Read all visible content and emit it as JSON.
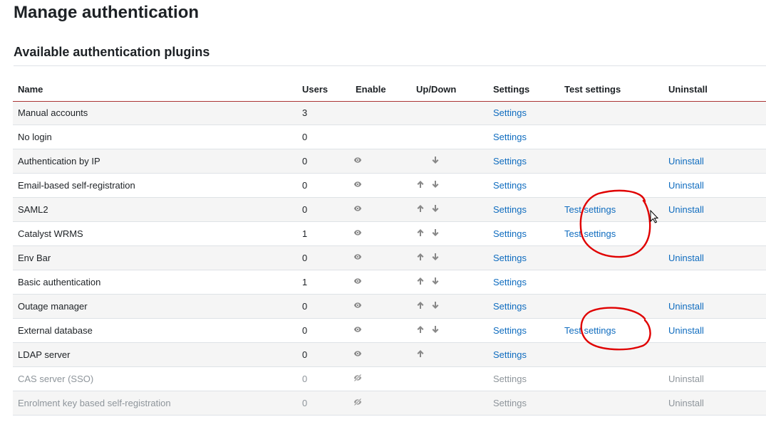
{
  "page": {
    "title": "Manage authentication",
    "section_title": "Available authentication plugins"
  },
  "table": {
    "headers": {
      "name": "Name",
      "users": "Users",
      "enable": "Enable",
      "updown": "Up/Down",
      "settings": "Settings",
      "test_settings": "Test settings",
      "uninstall": "Uninstall"
    },
    "rows": [
      {
        "name": "Manual accounts",
        "users": "3",
        "settings": "Settings"
      },
      {
        "name": "No login",
        "users": "0",
        "settings": "Settings"
      },
      {
        "name": "Authentication by IP",
        "users": "0",
        "settings": "Settings",
        "uninstall": "Uninstall"
      },
      {
        "name": "Email-based self-registration",
        "users": "0",
        "settings": "Settings",
        "uninstall": "Uninstall"
      },
      {
        "name": "SAML2",
        "users": "0",
        "settings": "Settings",
        "test": "Test settings",
        "uninstall": "Uninstall"
      },
      {
        "name": "Catalyst WRMS",
        "users": "1",
        "settings": "Settings",
        "test": "Test settings"
      },
      {
        "name": "Env Bar",
        "users": "0",
        "settings": "Settings",
        "uninstall": "Uninstall"
      },
      {
        "name": "Basic authentication",
        "users": "1",
        "settings": "Settings"
      },
      {
        "name": "Outage manager",
        "users": "0",
        "settings": "Settings",
        "uninstall": "Uninstall"
      },
      {
        "name": "External database",
        "users": "0",
        "settings": "Settings",
        "test": "Test settings",
        "uninstall": "Uninstall"
      },
      {
        "name": "LDAP server",
        "users": "0",
        "settings": "Settings"
      },
      {
        "name": "CAS server (SSO)",
        "users": "0",
        "settings": "Settings",
        "uninstall": "Uninstall"
      },
      {
        "name": "Enrolment key based self-registration",
        "users": "0",
        "settings": "Settings",
        "uninstall": "Uninstall"
      }
    ]
  },
  "colors": {
    "link": "#0f6cbf",
    "disabled_text": "#8e959b",
    "header_rule": "#a33333",
    "annotation": "#e00000"
  },
  "icons": {
    "enabled": "eye-icon",
    "disabled": "eye-slash-icon",
    "up": "arrow-up-icon",
    "down": "arrow-down-icon",
    "cursor": "mouse-cursor-icon"
  }
}
